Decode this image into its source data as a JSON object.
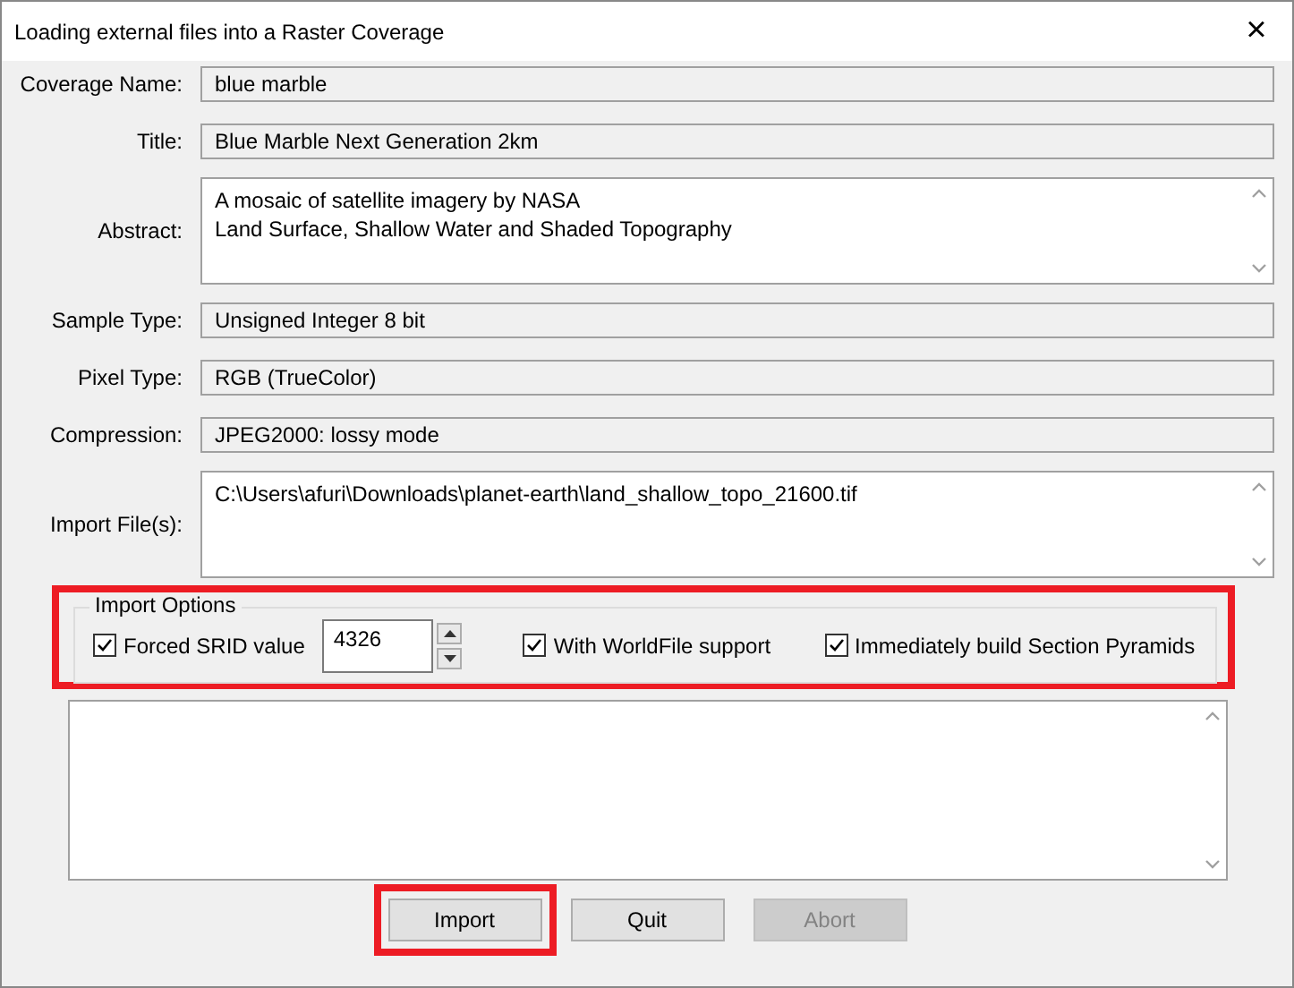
{
  "window": {
    "title": "Loading external files into a Raster Coverage",
    "close": "×"
  },
  "fields": [
    {
      "label": "Coverage Name:",
      "kind": "line",
      "value": "blue marble"
    },
    {
      "label": "Title:",
      "kind": "line",
      "value": "Blue Marble Next Generation 2km"
    },
    {
      "label": "Abstract:",
      "kind": "multiline",
      "lines": [
        "A mosaic of satellite imagery by NASA",
        "Land Surface, Shallow Water and Shaded Topography"
      ]
    },
    {
      "label": "Sample Type:",
      "kind": "line",
      "value": "Unsigned Integer 8 bit"
    },
    {
      "label": "Pixel Type:",
      "kind": "line",
      "value": "RGB (TrueColor)"
    },
    {
      "label": "Compression:",
      "kind": "line",
      "value": "JPEG2000: lossy mode"
    },
    {
      "label": "Import File(s):",
      "kind": "multiline",
      "lines": [
        "C:\\Users\\afuri\\Downloads\\planet-earth\\land_shallow_topo_21600.tif"
      ]
    }
  ],
  "import_options": {
    "title": "Import Options",
    "highlighted": true,
    "srid": {
      "label": "Forced SRID value",
      "checked": true,
      "value": "4326"
    },
    "checkboxes": [
      {
        "label": "With WorldFile support",
        "checked": true
      },
      {
        "label": "Immediately build Section Pyramids",
        "checked": true
      }
    ]
  },
  "buttons": [
    {
      "label": "Import",
      "disabled": false,
      "highlighted": true
    },
    {
      "label": "Quit",
      "disabled": false,
      "highlighted": false
    },
    {
      "label": "Abort",
      "disabled": true,
      "highlighted": false
    }
  ]
}
